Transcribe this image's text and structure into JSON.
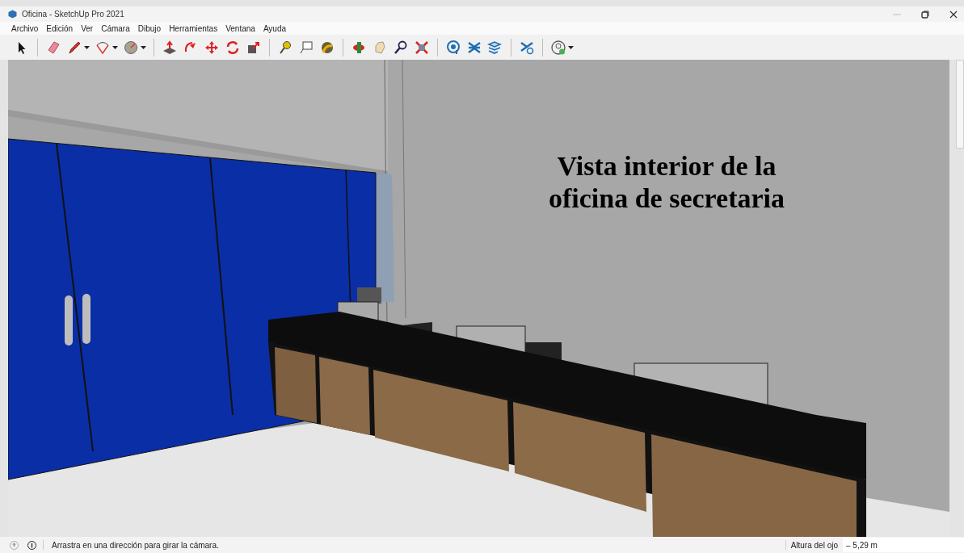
{
  "window": {
    "title": "Oficina - SketchUp Pro 2021"
  },
  "menu": [
    "Archivo",
    "Edición",
    "Ver",
    "Cámara",
    "Dibujo",
    "Herramientas",
    "Ventana",
    "Ayuda"
  ],
  "toolbar": {
    "groups": [
      [
        {
          "dropdown": false
        }
      ],
      [
        {
          "dropdown": false
        },
        {
          "dropdown": true
        },
        {
          "dropdown": true
        },
        {
          "dropdown": true
        }
      ],
      [
        {
          "dropdown": false
        },
        {
          "dropdown": false
        },
        {
          "dropdown": false
        },
        {
          "dropdown": false
        },
        {
          "dropdown": false
        }
      ],
      [
        {
          "dropdown": false
        },
        {
          "dropdown": false
        },
        {
          "dropdown": false
        }
      ],
      [
        {
          "dropdown": false
        },
        {
          "dropdown": false
        },
        {
          "dropdown": false
        },
        {
          "dropdown": false
        }
      ],
      [
        {
          "dropdown": false
        },
        {
          "dropdown": false
        },
        {
          "dropdown": false
        }
      ],
      [
        {
          "dropdown": false
        }
      ],
      [
        {
          "dropdown": true
        }
      ]
    ]
  },
  "viewport": {
    "caption": "Vista interior de la oficina de secretaria"
  },
  "status_bar": {
    "message": "Arrastra en una dirección para girar la cámara.",
    "measurement_label": "Altura del ojo",
    "measurement_value": "– 5,29 m"
  }
}
